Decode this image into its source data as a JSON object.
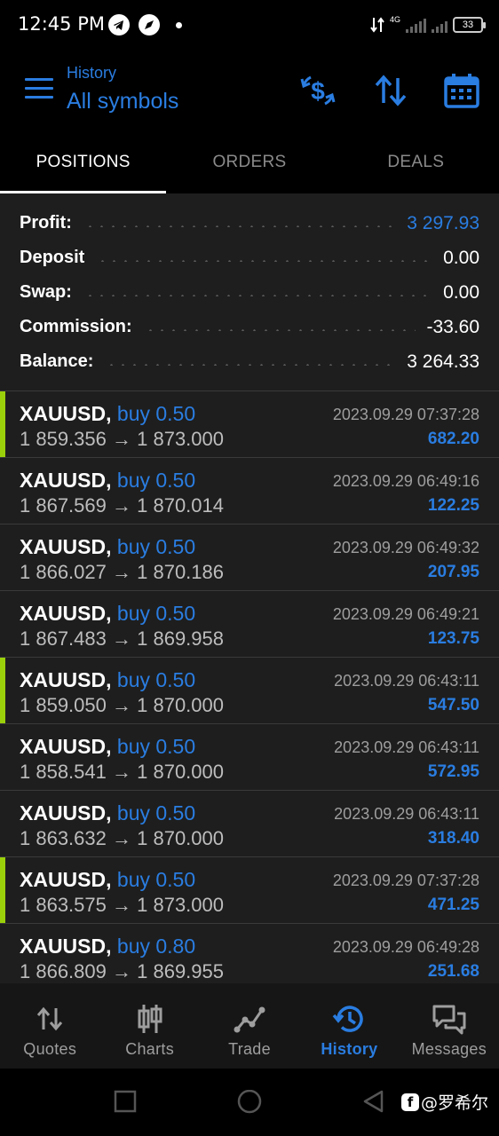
{
  "status_bar": {
    "time": "12:45 PM",
    "network": "4G",
    "battery": "33"
  },
  "header": {
    "subtitle": "History",
    "title": "All symbols",
    "icons": [
      "menu-icon",
      "currency-exchange-icon",
      "sort-icon",
      "calendar-icon"
    ],
    "accent_color": "#2a7de1"
  },
  "tabs": [
    {
      "label": "POSITIONS",
      "active": true
    },
    {
      "label": "ORDERS",
      "active": false
    },
    {
      "label": "DEALS",
      "active": false
    }
  ],
  "summary": [
    {
      "label": "Profit:",
      "value": "3 297.93",
      "color": "#2a7de1"
    },
    {
      "label": "Deposit",
      "value": "0.00",
      "color": "#ffffff"
    },
    {
      "label": "Swap:",
      "value": "0.00",
      "color": "#ffffff"
    },
    {
      "label": "Commission:",
      "value": "-33.60",
      "color": "#ffffff"
    },
    {
      "label": "Balance:",
      "value": "3 264.33",
      "color": "#ffffff"
    }
  ],
  "positions": [
    {
      "symbol": "XAUUSD,",
      "side": "buy 0.50",
      "open": "1 859.356",
      "close": "1 873.000",
      "time": "2023.09.29 07:37:28",
      "profit": "682.20",
      "flagged": true
    },
    {
      "symbol": "XAUUSD,",
      "side": "buy 0.50",
      "open": "1 867.569",
      "close": "1 870.014",
      "time": "2023.09.29 06:49:16",
      "profit": "122.25",
      "flagged": false
    },
    {
      "symbol": "XAUUSD,",
      "side": "buy 0.50",
      "open": "1 866.027",
      "close": "1 870.186",
      "time": "2023.09.29 06:49:32",
      "profit": "207.95",
      "flagged": false
    },
    {
      "symbol": "XAUUSD,",
      "side": "buy 0.50",
      "open": "1 867.483",
      "close": "1 869.958",
      "time": "2023.09.29 06:49:21",
      "profit": "123.75",
      "flagged": false
    },
    {
      "symbol": "XAUUSD,",
      "side": "buy 0.50",
      "open": "1 859.050",
      "close": "1 870.000",
      "time": "2023.09.29 06:43:11",
      "profit": "547.50",
      "flagged": true
    },
    {
      "symbol": "XAUUSD,",
      "side": "buy 0.50",
      "open": "1 858.541",
      "close": "1 870.000",
      "time": "2023.09.29 06:43:11",
      "profit": "572.95",
      "flagged": false
    },
    {
      "symbol": "XAUUSD,",
      "side": "buy 0.50",
      "open": "1 863.632",
      "close": "1 870.000",
      "time": "2023.09.29 06:43:11",
      "profit": "318.40",
      "flagged": false
    },
    {
      "symbol": "XAUUSD,",
      "side": "buy 0.50",
      "open": "1 863.575",
      "close": "1 873.000",
      "time": "2023.09.29 07:37:28",
      "profit": "471.25",
      "flagged": true
    },
    {
      "symbol": "XAUUSD,",
      "side": "buy 0.80",
      "open": "1 866.809",
      "close": "1 869.955",
      "time": "2023.09.29 06:49:28",
      "profit": "251.68",
      "flagged": false
    }
  ],
  "price_arrow": "→",
  "bottom_nav": [
    {
      "label": "Quotes",
      "icon": "quotes-icon",
      "active": false
    },
    {
      "label": "Charts",
      "icon": "charts-icon",
      "active": false
    },
    {
      "label": "Trade",
      "icon": "trade-icon",
      "active": false
    },
    {
      "label": "History",
      "icon": "history-icon",
      "active": true
    },
    {
      "label": "Messages",
      "icon": "messages-icon",
      "active": false
    }
  ],
  "watermark": "@罗希尔"
}
